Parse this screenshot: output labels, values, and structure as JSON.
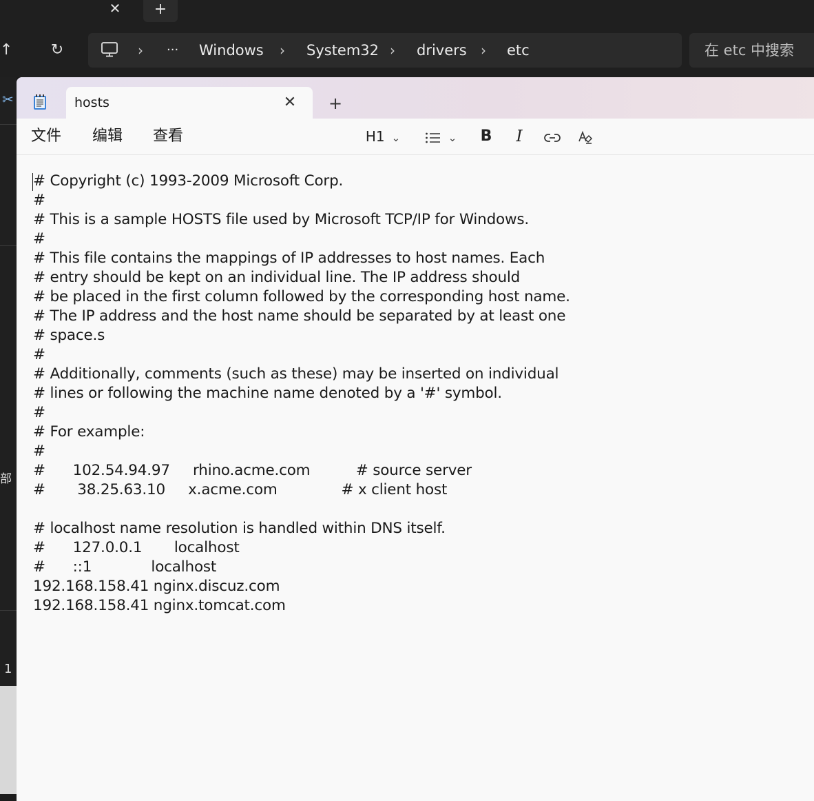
{
  "explorer": {
    "tab_close_glyph": "✕",
    "new_tab_glyph": "+",
    "up_glyph": "↑",
    "refresh_glyph": "↻",
    "more_glyph": "···",
    "breadcrumbs": [
      "Windows",
      "System32",
      "drivers",
      "etc"
    ],
    "search_placeholder": "在 etc 中搜索",
    "left_fragment_text": "部",
    "left_fragment_number": "1"
  },
  "notepad": {
    "tab_title": "hosts",
    "tab_close_glyph": "✕",
    "new_tab_glyph": "+",
    "menu": [
      "文件",
      "编辑",
      "查看"
    ],
    "toolbar": {
      "heading_label": "H1",
      "bold_label": "B",
      "italic_label": "I"
    },
    "lines": [
      "# Copyright (c) 1993-2009 Microsoft Corp.",
      "#",
      "# This is a sample HOSTS file used by Microsoft TCP/IP for Windows.",
      "#",
      "# This file contains the mappings of IP addresses to host names. Each",
      "# entry should be kept on an individual line. The IP address should",
      "# be placed in the first column followed by the corresponding host name.",
      "# The IP address and the host name should be separated by at least one",
      "# space.s",
      "#",
      "# Additionally, comments (such as these) may be inserted on individual",
      "# lines or following the machine name denoted by a '#' symbol.",
      "#",
      "# For example:",
      "#",
      "#      102.54.94.97     rhino.acme.com          # source server",
      "#       38.25.63.10     x.acme.com              # x client host",
      "",
      "# localhost name resolution is handled within DNS itself.",
      "#      127.0.0.1       localhost",
      "#      ::1             localhost",
      "192.168.158.41 nginx.discuz.com",
      "192.168.158.41 nginx.tomcat.com"
    ]
  }
}
